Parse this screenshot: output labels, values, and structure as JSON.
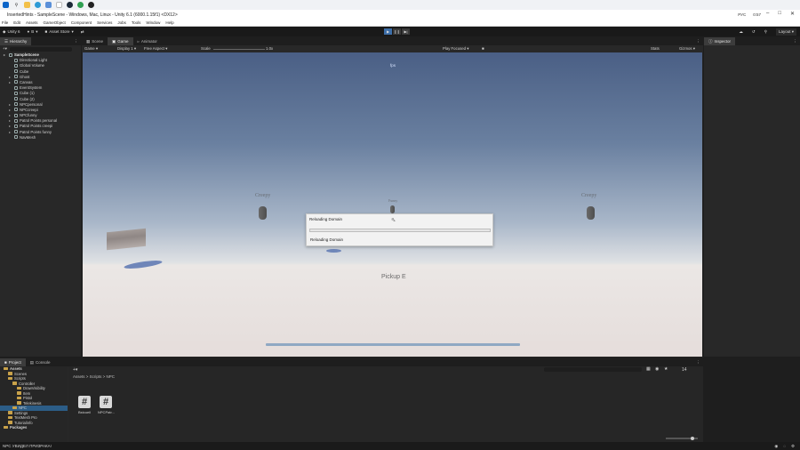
{
  "taskbar": {
    "icons": [
      "windows-icon",
      "search-icon",
      "folder-icon",
      "edge-icon",
      "store-icon",
      "app-icon",
      "steam-icon",
      "chrome-icon",
      "unity-icon"
    ]
  },
  "window": {
    "title": "InsertedHints - SampleScene - Windows, Mac, Linux - Unity 6.1 (6000.1.15f1) <DX12>"
  },
  "tray": {
    "lang": "РУС",
    "time": "0:57",
    "date": "01.09.2025"
  },
  "menu": [
    "File",
    "Edit",
    "Assets",
    "GameObject",
    "Component",
    "Services",
    "Jobs",
    "Tools",
    "Window",
    "Help"
  ],
  "toolbar": {
    "account": "Unity 6",
    "user": "B",
    "asset_store": "Asset Store",
    "layout": "Layout"
  },
  "hierarchy": {
    "tab": "Hierarchy",
    "rows": [
      {
        "label": "SampleScene",
        "indent": 0,
        "bold": true,
        "arrow": true
      },
      {
        "label": "Directional Light",
        "indent": 1
      },
      {
        "label": "Global Volume",
        "indent": 1
      },
      {
        "label": "Cube",
        "indent": 1
      },
      {
        "label": "Ghost",
        "indent": 1,
        "arrow": true
      },
      {
        "label": "Canvas",
        "indent": 1,
        "arrow": true
      },
      {
        "label": "EventSystem",
        "indent": 1
      },
      {
        "label": "Cube (1)",
        "indent": 1
      },
      {
        "label": "Cube (2)",
        "indent": 1
      },
      {
        "label": "NPCpersonal",
        "indent": 1,
        "arrow": true
      },
      {
        "label": "NPCcreepi",
        "indent": 1,
        "arrow": true
      },
      {
        "label": "NPCfunny",
        "indent": 1,
        "arrow": true
      },
      {
        "label": "Patrol Points personal",
        "indent": 1,
        "arrow": true
      },
      {
        "label": "Patrol Points creepi",
        "indent": 1,
        "arrow": true
      },
      {
        "label": "Patrol Points funny",
        "indent": 1,
        "arrow": true
      },
      {
        "label": "NavMesh",
        "indent": 1
      }
    ]
  },
  "scene_tabs": [
    "Scene",
    "Game",
    "Animator"
  ],
  "gamebar": {
    "mode": "Game",
    "display": "Display 1",
    "aspect": "Free Aspect",
    "scale_label": "Scale",
    "scale_value": "1.0x",
    "play": "Play Focused",
    "stats": "Stats",
    "gizmos": "Gizmos"
  },
  "viewport": {
    "fps": "fps",
    "npc_labels": [
      "Creepy",
      "Funny",
      "Creepy"
    ],
    "pickup": "Pickup E"
  },
  "dialog": {
    "title": "Reloading Domain",
    "status": "Reloading Domain",
    "progress": 0
  },
  "inspector": {
    "tab": "Inspector"
  },
  "project": {
    "tabs": [
      "Project",
      "Console"
    ],
    "tree": [
      {
        "label": "Assets",
        "indent": 0,
        "bold": true
      },
      {
        "label": "Scenes",
        "indent": 1
      },
      {
        "label": "Scripts",
        "indent": 1
      },
      {
        "label": "Controller",
        "indent": 2
      },
      {
        "label": "DrawVisibility",
        "indent": 3
      },
      {
        "label": "Item",
        "indent": 3
      },
      {
        "label": "Pistol",
        "indent": 3
      },
      {
        "label": "Telekinesis",
        "indent": 3
      },
      {
        "label": "NPC",
        "indent": 2,
        "selected": true
      },
      {
        "label": "Settings",
        "indent": 1
      },
      {
        "label": "TextMesh Pro",
        "indent": 1
      },
      {
        "label": "Tutorialinfo",
        "indent": 1
      },
      {
        "label": "Packages",
        "indent": 0,
        "bold": true
      }
    ],
    "breadcrumb": "Assets > Scripts > NPC",
    "files": [
      {
        "label": "Bstcueil",
        "icon": "#"
      },
      {
        "label": "NPCPatr...",
        "icon": "#"
      }
    ],
    "count": "14"
  },
  "status": {
    "text": "NPC УВИДЕЛ ПРИЗРАКА!"
  }
}
